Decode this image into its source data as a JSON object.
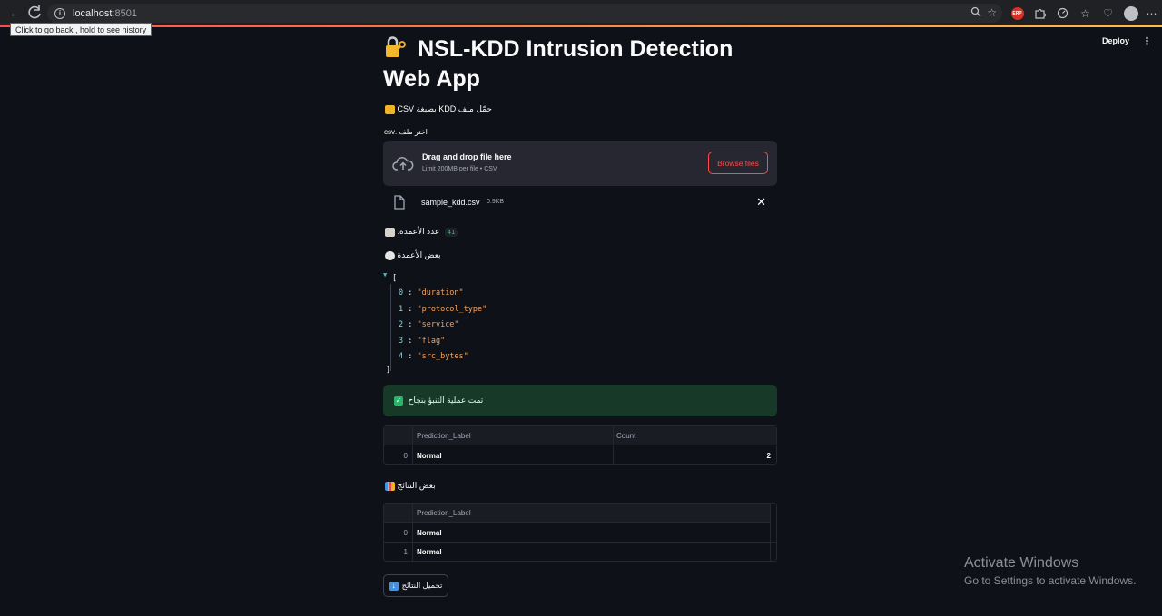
{
  "browser": {
    "url_host": "localhost",
    "url_port": ":8501",
    "tooltip": "Click to go back , hold to see history",
    "ext_badge": "ERP"
  },
  "header": {
    "deploy_label": "Deploy",
    "menu_icon": "kebab-icon"
  },
  "app": {
    "title": "NSL-KDD Intrusion Detection Web App",
    "title_icon": "lock-key-icon",
    "upload_heading": "حمّل ملف KDD بصيغة CSV",
    "file_input_label": "اختر ملف .csv",
    "uploader": {
      "drag_text": "Drag and drop file here",
      "limit_text": "Limit 200MB per file • CSV",
      "browse_label": "Browse files"
    },
    "uploaded_file": {
      "name": "sample_kdd.csv",
      "size": "0.9KB"
    },
    "columns_count_label": "عدد الأعمدة:",
    "columns_count": "41",
    "some_columns_label": "بعض الأعمدة",
    "json_columns": [
      {
        "index": "0",
        "value": "\"duration\""
      },
      {
        "index": "1",
        "value": "\"protocol_type\""
      },
      {
        "index": "2",
        "value": "\"service\""
      },
      {
        "index": "3",
        "value": "\"flag\""
      },
      {
        "index": "4",
        "value": "\"src_bytes\""
      }
    ],
    "json_open": "[",
    "json_close": "]",
    "success_message": "تمت عملية التنبؤ بنجاح",
    "counts_table": {
      "headers": [
        "Prediction_Label",
        "Count"
      ],
      "rows": [
        {
          "index": "0",
          "label": "Normal",
          "count": "2"
        }
      ]
    },
    "some_results_label": "بعض النتائج",
    "results_table": {
      "headers": [
        "Prediction_Label"
      ],
      "rows": [
        {
          "index": "0",
          "label": "Normal"
        },
        {
          "index": "1",
          "label": "Normal"
        }
      ]
    },
    "download_label": "تحميل النتائج"
  },
  "watermark": {
    "line1": "Activate Windows",
    "line2": "Go to Settings to activate Windows."
  },
  "colors": {
    "background": "#0e1117",
    "accent": "#ff4b4b",
    "success_bg": "#173928"
  }
}
